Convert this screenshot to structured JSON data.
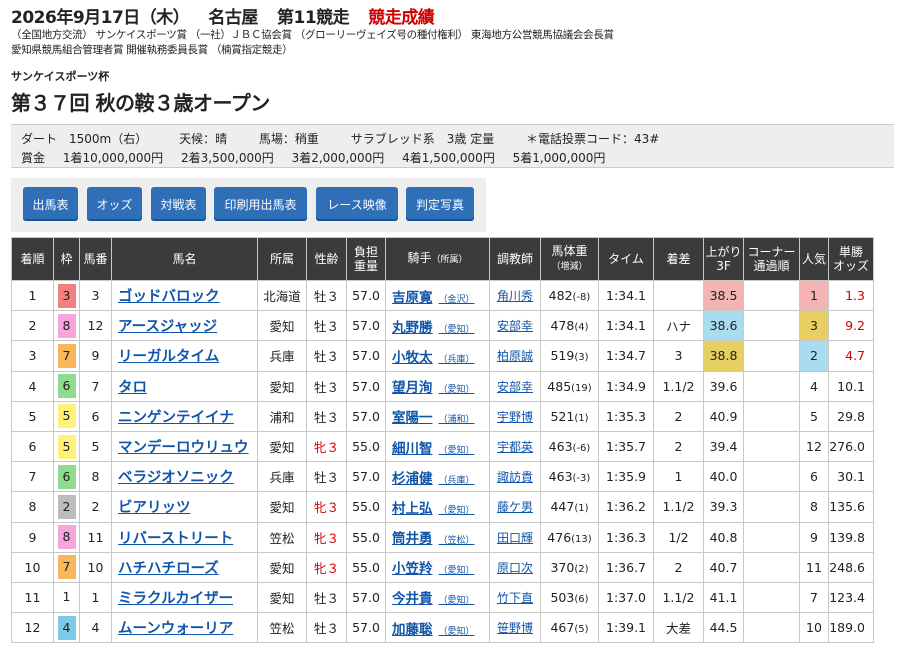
{
  "header": {
    "date": "2026年9月17日（木）",
    "venue": "名古屋",
    "race_no": "第11競走",
    "status": "競走成績",
    "awards_line1": "（全国地方交流） サンケイスポーツ賞 （一社）ＪＢＣ協会賞 （グローリーヴェイズ号の種付権利） 東海地方公営競馬協議会会長賞",
    "awards_line2": "愛知県競馬組合管理者賞 開催執務委員長賞 （楠賞指定競走）",
    "sponsor": "サンケイスポーツ杯",
    "race_name": "第３７回 秋の鞍３歳オープン"
  },
  "info": {
    "course": "ダート　1500m（右）",
    "weather": "天候：晴",
    "track": "馬場：稍重",
    "condition": "サラブレッド系　3歳 定量",
    "phone_code": "＊電話投票コード：43#",
    "prize_label": "賞金",
    "prizes": [
      "1着10,000,000円",
      "2着3,500,000円",
      "3着2,000,000円",
      "4着1,500,000円",
      "5着1,000,000円"
    ]
  },
  "buttons": [
    "出馬表",
    "オッズ",
    "対戦表",
    "印刷用出馬表",
    "レース映像",
    "判定写真"
  ],
  "table": {
    "headers": {
      "rank": "着順",
      "waku": "枠",
      "umaban": "馬番",
      "horse": "馬名",
      "region": "所属",
      "sexage": "性齢",
      "weight_l1": "負担",
      "weight_l2": "重量",
      "jockey": "騎手",
      "jockey_sub": "（所属）",
      "trainer": "調教師",
      "bw_l1": "馬体重",
      "bw_l2": "（増減）",
      "time": "タイム",
      "margin": "着差",
      "last3f_l1": "上がり",
      "last3f_l2": "3F",
      "corner_l1": "コーナー",
      "corner_l2": "通過順",
      "pop": "人気",
      "odds_l1": "単勝",
      "odds_l2": "オッズ"
    },
    "rows": [
      {
        "rank": "1",
        "waku": "3",
        "umaban": "3",
        "horse": "ゴッドバロック",
        "region": "北海道",
        "sexage": "牡３",
        "weight": "57.0",
        "jockey": "吉原寛",
        "jarea": "（金沢）",
        "trainer": "角川秀",
        "bw": "482",
        "bwd": "(-8)",
        "time": "1:34.1",
        "margin": "",
        "last3f": "38.5",
        "pop": "1",
        "odds": "1.3"
      },
      {
        "rank": "2",
        "waku": "8",
        "umaban": "12",
        "horse": "アースジャッジ",
        "region": "愛知",
        "sexage": "牡３",
        "weight": "57.0",
        "jockey": "丸野勝",
        "jarea": "（愛知）",
        "trainer": "安部幸",
        "bw": "478",
        "bwd": "(4)",
        "time": "1:34.1",
        "margin": "ハナ",
        "last3f": "38.6",
        "pop": "3",
        "odds": "9.2"
      },
      {
        "rank": "3",
        "waku": "7",
        "umaban": "9",
        "horse": "リーガルタイム",
        "region": "兵庫",
        "sexage": "牡３",
        "weight": "57.0",
        "jockey": "小牧太",
        "jarea": "（兵庫）",
        "trainer": "柏原誠",
        "bw": "519",
        "bwd": "(3)",
        "time": "1:34.7",
        "margin": "3",
        "last3f": "38.8",
        "pop": "2",
        "odds": "4.7"
      },
      {
        "rank": "4",
        "waku": "6",
        "umaban": "7",
        "horse": "タロ",
        "region": "愛知",
        "sexage": "牡３",
        "weight": "57.0",
        "jockey": "望月洵",
        "jarea": "（愛知）",
        "trainer": "安部幸",
        "bw": "485",
        "bwd": "(19)",
        "time": "1:34.9",
        "margin": "1.1/2",
        "last3f": "39.6",
        "pop": "4",
        "odds": "10.1"
      },
      {
        "rank": "5",
        "waku": "5",
        "umaban": "6",
        "horse": "ニンゲンテイイナ",
        "region": "浦和",
        "sexage": "牡３",
        "weight": "57.0",
        "jockey": "室陽一",
        "jarea": "（浦和）",
        "trainer": "宇野博",
        "bw": "521",
        "bwd": "(1)",
        "time": "1:35.3",
        "margin": "2",
        "last3f": "40.9",
        "pop": "5",
        "odds": "29.8"
      },
      {
        "rank": "6",
        "waku": "5",
        "umaban": "5",
        "horse": "マンデーロウリュウ",
        "region": "愛知",
        "sexage": "牝３",
        "weight": "55.0",
        "jockey": "細川智",
        "jarea": "（愛知）",
        "trainer": "宇都英",
        "bw": "463",
        "bwd": "(-6)",
        "time": "1:35.7",
        "margin": "2",
        "last3f": "39.4",
        "pop": "12",
        "odds": "276.0"
      },
      {
        "rank": "7",
        "waku": "6",
        "umaban": "8",
        "horse": "ベラジオソニック",
        "region": "兵庫",
        "sexage": "牡３",
        "weight": "57.0",
        "jockey": "杉浦健",
        "jarea": "（兵庫）",
        "trainer": "諏訪貴",
        "bw": "463",
        "bwd": "(-3)",
        "time": "1:35.9",
        "margin": "1",
        "last3f": "40.0",
        "pop": "6",
        "odds": "30.1"
      },
      {
        "rank": "8",
        "waku": "2",
        "umaban": "2",
        "horse": "ビアリッツ",
        "region": "愛知",
        "sexage": "牝３",
        "weight": "55.0",
        "jockey": "村上弘",
        "jarea": "（愛知）",
        "trainer": "藤ケ男",
        "bw": "447",
        "bwd": "(1)",
        "time": "1:36.2",
        "margin": "1.1/2",
        "last3f": "39.3",
        "pop": "8",
        "odds": "135.6"
      },
      {
        "rank": "9",
        "waku": "8",
        "umaban": "11",
        "horse": "リバーストリート",
        "region": "笠松",
        "sexage": "牝３",
        "weight": "55.0",
        "jockey": "筒井勇",
        "jarea": "（笠松）",
        "trainer": "田口輝",
        "bw": "476",
        "bwd": "(13)",
        "time": "1:36.3",
        "margin": "1/2",
        "last3f": "40.8",
        "pop": "9",
        "odds": "139.8"
      },
      {
        "rank": "10",
        "waku": "7",
        "umaban": "10",
        "horse": "ハチハチローズ",
        "region": "愛知",
        "sexage": "牝３",
        "weight": "55.0",
        "jockey": "小笠羚",
        "jarea": "（愛知）",
        "trainer": "原口次",
        "bw": "370",
        "bwd": "(2)",
        "time": "1:36.7",
        "margin": "2",
        "last3f": "40.7",
        "pop": "11",
        "odds": "248.6"
      },
      {
        "rank": "11",
        "waku": "1",
        "umaban": "1",
        "horse": "ミラクルカイザー",
        "region": "愛知",
        "sexage": "牡３",
        "weight": "57.0",
        "jockey": "今井貴",
        "jarea": "（愛知）",
        "trainer": "竹下直",
        "bw": "503",
        "bwd": "(6)",
        "time": "1:37.0",
        "margin": "1.1/2",
        "last3f": "41.1",
        "pop": "7",
        "odds": "123.4"
      },
      {
        "rank": "12",
        "waku": "4",
        "umaban": "4",
        "horse": "ムーンウォーリア",
        "region": "笠松",
        "sexage": "牡３",
        "weight": "57.0",
        "jockey": "加藤聡",
        "jarea": "（愛知）",
        "trainer": "笹野博",
        "bw": "467",
        "bwd": "(5)",
        "time": "1:39.1",
        "margin": "大差",
        "last3f": "44.5",
        "pop": "10",
        "odds": "189.0"
      }
    ],
    "waku_colors": {
      "1": "#ffffff",
      "2": "#bcbcbc",
      "3": "#f28080",
      "4": "#7ec8e8",
      "5": "#fff27a",
      "6": "#8fdc8f",
      "7": "#f7b75a",
      "8": "#f7a6dd"
    },
    "top_highlight": {
      "first": "#f4b4b4",
      "second": "#a9dcef",
      "third": "#e8cf61"
    }
  }
}
